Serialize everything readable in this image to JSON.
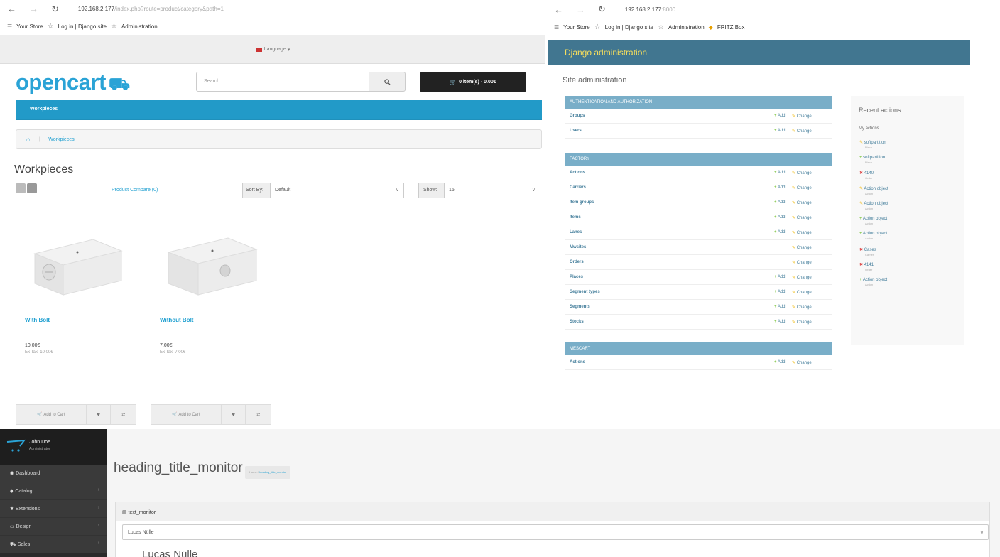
{
  "left_browser": {
    "nav": {
      "back": "←",
      "forward": "→",
      "reload": "↻"
    },
    "url": "192.168.2.177",
    "url_path": "/index.php?route=product/category&path=1",
    "bookmarks": [
      "Your Store",
      "Log in | Django site",
      "Administration"
    ],
    "language_label": "Language",
    "logo": "opencart",
    "search_placeholder": "Search",
    "cart_label": "0 item(s) - 0.00€",
    "menu_item": "Workpieces",
    "breadcrumb": "Workpieces",
    "page_title": "Workpieces",
    "product_compare": "Product Compare (0)",
    "sort_label": "Sort By:",
    "sort_value": "Default",
    "show_label": "Show:",
    "show_value": "15",
    "products": [
      {
        "name": "With Bolt",
        "price": "10.00€",
        "ex_tax": "Ex Tax: 10.00€",
        "add": "Add to Cart"
      },
      {
        "name": "Without Bolt",
        "price": "7.00€",
        "ex_tax": "Ex Tax: 7.00€",
        "add": "Add to Cart"
      }
    ]
  },
  "right_browser": {
    "nav": {
      "back": "←",
      "forward": "→",
      "reload": "↻"
    },
    "url": "192.168.2.177",
    "url_port": ":8000",
    "bookmarks": [
      "Your Store",
      "Log in | Django site",
      "Administration",
      "FRITZ!Box"
    ],
    "header": "Django administration",
    "site_title": "Site administration",
    "auth_module": {
      "caption": "Authentication and Authorization",
      "rows": [
        {
          "name": "Groups",
          "add": "Add",
          "change": "Change"
        },
        {
          "name": "Users",
          "add": "Add",
          "change": "Change"
        }
      ]
    },
    "factory_module": {
      "caption": "Factory",
      "rows": [
        {
          "name": "Actions",
          "add": "Add",
          "change": "Change"
        },
        {
          "name": "Carriers",
          "add": "Add",
          "change": "Change"
        },
        {
          "name": "Item groups",
          "add": "Add",
          "change": "Change"
        },
        {
          "name": "Items",
          "add": "Add",
          "change": "Change"
        },
        {
          "name": "Lanes",
          "add": "Add",
          "change": "Change"
        },
        {
          "name": "Mwsites",
          "add": "",
          "change": "Change"
        },
        {
          "name": "Orders",
          "add": "",
          "change": "Change"
        },
        {
          "name": "Places",
          "add": "Add",
          "change": "Change"
        },
        {
          "name": "Segment types",
          "add": "Add",
          "change": "Change"
        },
        {
          "name": "Segments",
          "add": "Add",
          "change": "Change"
        },
        {
          "name": "Stocks",
          "add": "Add",
          "change": "Change"
        }
      ]
    },
    "third_module": {
      "caption": "Mescart",
      "rows": [
        {
          "name": "Actions",
          "add": "Add",
          "change": "Change"
        }
      ]
    },
    "recent_actions": {
      "title": "Recent actions",
      "subtitle": "My actions",
      "items": [
        {
          "icon": "pencil",
          "label": "soft‌partition",
          "sub": "Place"
        },
        {
          "icon": "plus",
          "label": "soft‌partition",
          "sub": "Place"
        },
        {
          "icon": "cross",
          "label": "4140",
          "sub": "Order"
        },
        {
          "icon": "pencil",
          "label": "Action object",
          "sub": "Action"
        },
        {
          "icon": "pencil",
          "label": "Action object",
          "sub": "Action"
        },
        {
          "icon": "plus",
          "label": "Action object",
          "sub": "Action"
        },
        {
          "icon": "plus",
          "label": "Action object",
          "sub": "Action"
        },
        {
          "icon": "cross",
          "label": "Cases",
          "sub": "Carrier"
        },
        {
          "icon": "cross",
          "label": "4141",
          "sub": "Order"
        },
        {
          "icon": "plus",
          "label": "Action object",
          "sub": "Action"
        }
      ]
    }
  },
  "bottom_admin": {
    "user_name": "John Doe",
    "user_role": "Administrator",
    "nav": [
      "Dashboard",
      "Catalog",
      "Extensions",
      "Design",
      "Sales"
    ],
    "heading": "heading_title_monitor",
    "breadcrumb_home": "Home",
    "breadcrumb_current": "heading_title_monitor",
    "panel_title": "text_monitor",
    "select_value": "Lucas Nülle",
    "big_name": "Lucas Nülle"
  },
  "colors": {
    "opencart_blue": "#229ac8",
    "django_header": "#417690",
    "django_caption": "#79aec8",
    "admin_sidebar": "#2b2b2b"
  }
}
